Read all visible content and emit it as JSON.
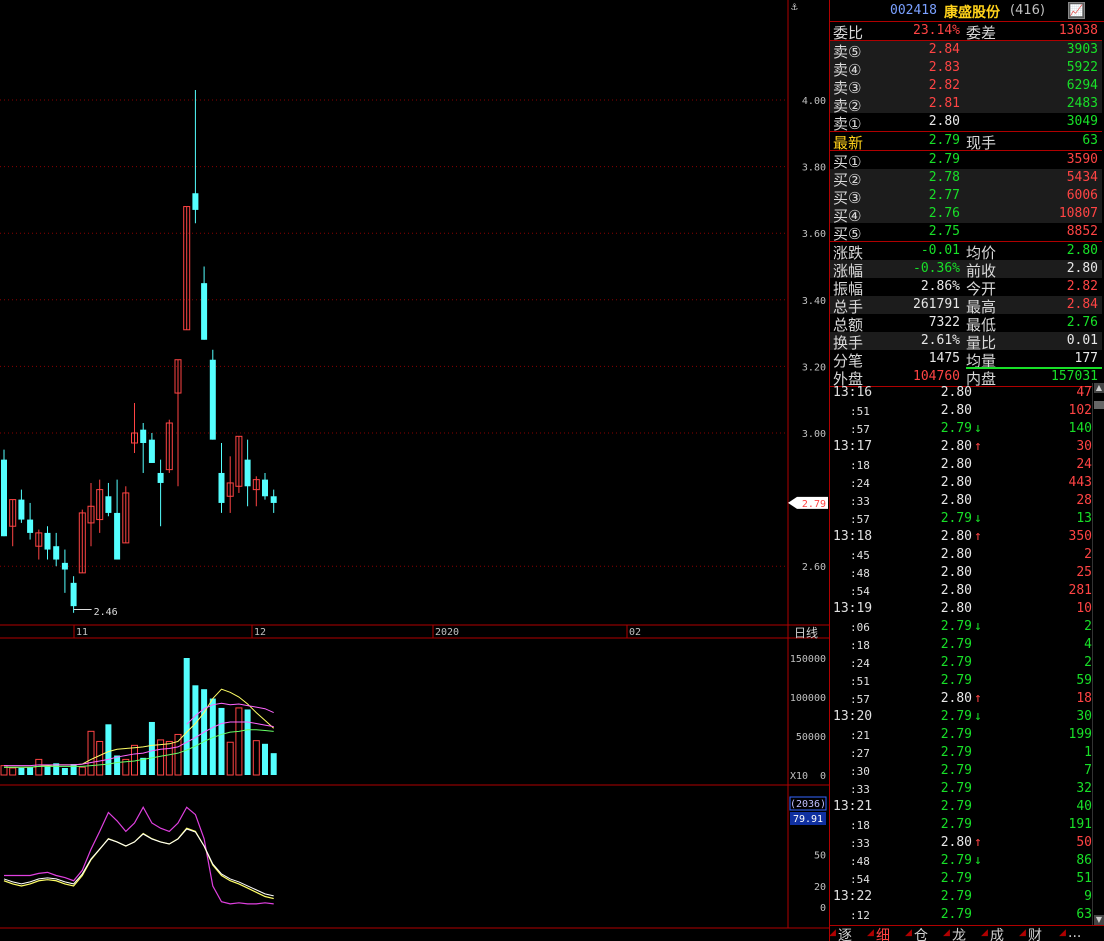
{
  "chart_data": [
    {
      "type": "candlestick",
      "period_label": "日线",
      "y_ticks": [
        "4.00",
        "3.80",
        "3.60",
        "3.40",
        "3.20",
        "3.00",
        "2.60"
      ],
      "x_labels": [
        "11",
        "12",
        "2020",
        "02"
      ],
      "current_price_tag": "2.79",
      "low_marker": "2.46",
      "candles": [
        {
          "o": 2.92,
          "h": 2.95,
          "l": 2.69,
          "c": 2.69
        },
        {
          "o": 2.72,
          "h": 2.8,
          "l": 2.66,
          "c": 2.8
        },
        {
          "o": 2.8,
          "h": 2.83,
          "l": 2.73,
          "c": 2.74
        },
        {
          "o": 2.74,
          "h": 2.79,
          "l": 2.68,
          "c": 2.7
        },
        {
          "o": 2.66,
          "h": 2.71,
          "l": 2.62,
          "c": 2.7
        },
        {
          "o": 2.7,
          "h": 2.72,
          "l": 2.62,
          "c": 2.65
        },
        {
          "o": 2.66,
          "h": 2.7,
          "l": 2.6,
          "c": 2.62
        },
        {
          "o": 2.61,
          "h": 2.65,
          "l": 2.52,
          "c": 2.59
        },
        {
          "o": 2.55,
          "h": 2.57,
          "l": 2.46,
          "c": 2.48
        },
        {
          "o": 2.58,
          "h": 2.77,
          "l": 2.58,
          "c": 2.76
        },
        {
          "o": 2.73,
          "h": 2.85,
          "l": 2.66,
          "c": 2.78
        },
        {
          "o": 2.74,
          "h": 2.86,
          "l": 2.7,
          "c": 2.83
        },
        {
          "o": 2.81,
          "h": 2.85,
          "l": 2.75,
          "c": 2.76
        },
        {
          "o": 2.76,
          "h": 2.86,
          "l": 2.62,
          "c": 2.62
        },
        {
          "o": 2.67,
          "h": 2.84,
          "l": 2.67,
          "c": 2.82
        },
        {
          "o": 2.97,
          "h": 3.09,
          "l": 2.94,
          "c": 3.0
        },
        {
          "o": 3.01,
          "h": 3.03,
          "l": 2.88,
          "c": 2.97
        },
        {
          "o": 2.98,
          "h": 3.0,
          "l": 2.91,
          "c": 2.91
        },
        {
          "o": 2.88,
          "h": 2.92,
          "l": 2.72,
          "c": 2.85
        },
        {
          "o": 2.89,
          "h": 3.04,
          "l": 2.88,
          "c": 3.03
        },
        {
          "o": 3.12,
          "h": 3.22,
          "l": 2.84,
          "c": 3.22
        },
        {
          "o": 3.31,
          "h": 3.68,
          "l": 3.31,
          "c": 3.68
        },
        {
          "o": 3.72,
          "h": 4.03,
          "l": 3.63,
          "c": 3.67
        },
        {
          "o": 3.45,
          "h": 3.5,
          "l": 3.28,
          "c": 3.28
        },
        {
          "o": 3.22,
          "h": 3.25,
          "l": 2.98,
          "c": 2.98
        },
        {
          "o": 2.88,
          "h": 2.97,
          "l": 2.76,
          "c": 2.79
        },
        {
          "o": 2.81,
          "h": 2.93,
          "l": 2.76,
          "c": 2.85
        },
        {
          "o": 2.84,
          "h": 2.99,
          "l": 2.82,
          "c": 2.99
        },
        {
          "o": 2.92,
          "h": 2.98,
          "l": 2.78,
          "c": 2.84
        },
        {
          "o": 2.83,
          "h": 2.87,
          "l": 2.78,
          "c": 2.86
        },
        {
          "o": 2.86,
          "h": 2.88,
          "l": 2.8,
          "c": 2.81
        },
        {
          "o": 2.81,
          "h": 2.83,
          "l": 2.76,
          "c": 2.79
        }
      ]
    },
    {
      "type": "bar",
      "x10_label": "X10",
      "y_ticks": [
        "150000",
        "100000",
        "50000",
        "0"
      ],
      "values": [
        12000,
        9000,
        9000,
        10000,
        20000,
        11000,
        15000,
        9000,
        14000,
        10000,
        56000,
        43000,
        65000,
        25000,
        20000,
        38000,
        22000,
        68000,
        45000,
        43000,
        52000,
        150000,
        115000,
        110000,
        98000,
        86000,
        42000,
        86000,
        84000,
        44000,
        40000,
        28000
      ],
      "up": [
        true,
        true,
        false,
        false,
        true,
        false,
        false,
        false,
        false,
        true,
        true,
        true,
        false,
        false,
        true,
        true,
        false,
        false,
        true,
        true,
        true,
        false,
        false,
        false,
        false,
        false,
        true,
        true,
        false,
        true,
        false,
        false
      ],
      "ma_series": [
        {
          "values": [
            10000,
            10000,
            10000,
            10000,
            11000,
            12000,
            13000,
            13000,
            13000,
            14000,
            20000,
            25000,
            30000,
            33000,
            34000,
            35000,
            36000,
            38000,
            39000,
            40000,
            43000,
            55000,
            66000,
            80000,
            98000,
            110000,
            106000,
            100000,
            91000,
            80000,
            70000,
            60000
          ]
        },
        {
          "values": [
            12000,
            12000,
            12000,
            12000,
            13000,
            13000,
            13000,
            13000,
            13000,
            14000,
            16000,
            18000,
            20000,
            23000,
            25000,
            27000,
            28000,
            31000,
            33000,
            34000,
            36000,
            42000,
            48000,
            55000,
            61000,
            66000,
            68000,
            68000,
            68000,
            66000,
            64000,
            62000
          ]
        },
        {
          "values": [
            10000,
            10000,
            10000,
            10000,
            11000,
            11000,
            11000,
            11000,
            11000,
            11000,
            12000,
            13000,
            14000,
            16000,
            17000,
            18000,
            20000,
            22000,
            24000,
            26000,
            28000,
            32000,
            37000,
            43000,
            48000,
            52000,
            55000,
            56000,
            58000,
            58000,
            57000,
            56000
          ]
        },
        {
          "values": [
            null,
            null,
            null,
            null,
            null,
            null,
            null,
            null,
            null,
            null,
            null,
            null,
            null,
            null,
            null,
            null,
            null,
            null,
            null,
            null,
            null,
            65000,
            76000,
            85000,
            90000,
            92000,
            90000,
            91000,
            89000,
            87000,
            85000,
            80000
          ]
        }
      ]
    },
    {
      "type": "line",
      "value_box": "(2036)",
      "value": "79.91",
      "y_ticks": [
        "50",
        "20",
        "0"
      ],
      "series": [
        {
          "values": [
            30,
            30,
            30,
            30,
            32,
            33,
            30,
            28,
            25,
            35,
            55,
            72,
            90,
            82,
            72,
            80,
            95,
            80,
            75,
            72,
            80,
            95,
            88,
            65,
            20,
            5,
            3,
            4,
            3,
            3,
            4,
            3
          ]
        },
        {
          "values": [
            25,
            22,
            20,
            22,
            25,
            26,
            25,
            22,
            20,
            30,
            45,
            55,
            65,
            62,
            58,
            62,
            70,
            65,
            62,
            60,
            65,
            75,
            72,
            58,
            40,
            30,
            25,
            22,
            18,
            14,
            10,
            8
          ]
        }
      ]
    }
  ],
  "quote": {
    "code": "002418",
    "name": "康盛股份",
    "count": "(416)",
    "btn": "📈",
    "wb_label": "委比",
    "wb_value": "23.14%",
    "wc_label": "委差",
    "wc_value": "13038",
    "sells": [
      {
        "label": "卖⑤",
        "price": "2.84",
        "vol": "3903"
      },
      {
        "label": "卖④",
        "price": "2.83",
        "vol": "5922"
      },
      {
        "label": "卖③",
        "price": "2.82",
        "vol": "6294"
      },
      {
        "label": "卖②",
        "price": "2.81",
        "vol": "2483"
      },
      {
        "label": "卖①",
        "price": "2.80",
        "vol": "3049"
      }
    ],
    "latest_label": "最新",
    "latest_price": "2.79",
    "hand_label": "现手",
    "hand_value": "63",
    "buys": [
      {
        "label": "买①",
        "price": "2.79",
        "vol": "3590"
      },
      {
        "label": "买②",
        "price": "2.78",
        "vol": "5434"
      },
      {
        "label": "买③",
        "price": "2.77",
        "vol": "6006"
      },
      {
        "label": "买④",
        "price": "2.76",
        "vol": "10807"
      },
      {
        "label": "买⑤",
        "price": "2.75",
        "vol": "8852"
      }
    ],
    "stats": [
      {
        "l1": "涨跌",
        "v1": "-0.01",
        "l2": "均价",
        "v2": "2.80"
      },
      {
        "l1": "涨幅",
        "v1": "-0.36%",
        "l2": "前收",
        "v2": "2.80"
      },
      {
        "l1": "振幅",
        "v1": "2.86%",
        "l2": "今开",
        "v2": "2.82"
      },
      {
        "l1": "总手",
        "v1": "261791",
        "l2": "最高",
        "v2": "2.84"
      },
      {
        "l1": "总额",
        "v1": "7322",
        "l2": "最低",
        "v2": "2.76"
      },
      {
        "l1": "换手",
        "v1": "2.61%",
        "l2": "量比",
        "v2": "0.01"
      },
      {
        "l1": "分笔",
        "v1": "1475",
        "l2": "均量",
        "v2": "177"
      }
    ],
    "outer_label": "外盘",
    "outer_value": "104760",
    "inner_label": "内盘",
    "inner_value": "157031"
  },
  "ticks": [
    {
      "t": "13:16",
      "p": "2.80",
      "a": "",
      "v": "47"
    },
    {
      "t": ":51",
      "p": "2.80",
      "a": "",
      "v": "102"
    },
    {
      "t": ":57",
      "p": "2.79",
      "a": "↓",
      "v": "140"
    },
    {
      "t": "13:17",
      "p": "2.80",
      "a": "↑",
      "v": "30"
    },
    {
      "t": ":18",
      "p": "2.80",
      "a": "",
      "v": "24"
    },
    {
      "t": ":24",
      "p": "2.80",
      "a": "",
      "v": "443"
    },
    {
      "t": ":33",
      "p": "2.80",
      "a": "",
      "v": "28"
    },
    {
      "t": ":57",
      "p": "2.79",
      "a": "↓",
      "v": "13"
    },
    {
      "t": "13:18",
      "p": "2.80",
      "a": "↑",
      "v": "350"
    },
    {
      "t": ":45",
      "p": "2.80",
      "a": "",
      "v": "2"
    },
    {
      "t": ":48",
      "p": "2.80",
      "a": "",
      "v": "25"
    },
    {
      "t": ":54",
      "p": "2.80",
      "a": "",
      "v": "281"
    },
    {
      "t": "13:19",
      "p": "2.80",
      "a": "",
      "v": "10"
    },
    {
      "t": ":06",
      "p": "2.79",
      "a": "↓",
      "v": "2"
    },
    {
      "t": ":18",
      "p": "2.79",
      "a": "",
      "v": "4"
    },
    {
      "t": ":24",
      "p": "2.79",
      "a": "",
      "v": "2"
    },
    {
      "t": ":51",
      "p": "2.79",
      "a": "",
      "v": "59"
    },
    {
      "t": ":57",
      "p": "2.80",
      "a": "↑",
      "v": "18"
    },
    {
      "t": "13:20",
      "p": "2.79",
      "a": "↓",
      "v": "30"
    },
    {
      "t": ":21",
      "p": "2.79",
      "a": "",
      "v": "199"
    },
    {
      "t": ":27",
      "p": "2.79",
      "a": "",
      "v": "1"
    },
    {
      "t": ":30",
      "p": "2.79",
      "a": "",
      "v": "7"
    },
    {
      "t": ":33",
      "p": "2.79",
      "a": "",
      "v": "32"
    },
    {
      "t": "13:21",
      "p": "2.79",
      "a": "",
      "v": "40"
    },
    {
      "t": ":18",
      "p": "2.79",
      "a": "",
      "v": "191"
    },
    {
      "t": ":33",
      "p": "2.80",
      "a": "↑",
      "v": "50"
    },
    {
      "t": ":48",
      "p": "2.79",
      "a": "↓",
      "v": "86"
    },
    {
      "t": ":54",
      "p": "2.79",
      "a": "",
      "v": "51"
    },
    {
      "t": "13:22",
      "p": "2.79",
      "a": "",
      "v": "9"
    },
    {
      "t": ":12",
      "p": "2.79",
      "a": "",
      "v": "63"
    }
  ],
  "tabs": [
    "逐",
    "细",
    "仓",
    "龙",
    "成",
    "财",
    "..."
  ],
  "colors": {
    "up": "#ff4444",
    "down": "#18e028",
    "cyan": "#54ffff",
    "grid": "#b00000",
    "yellow": "#ffd21a",
    "magenta": "#e040e0"
  }
}
